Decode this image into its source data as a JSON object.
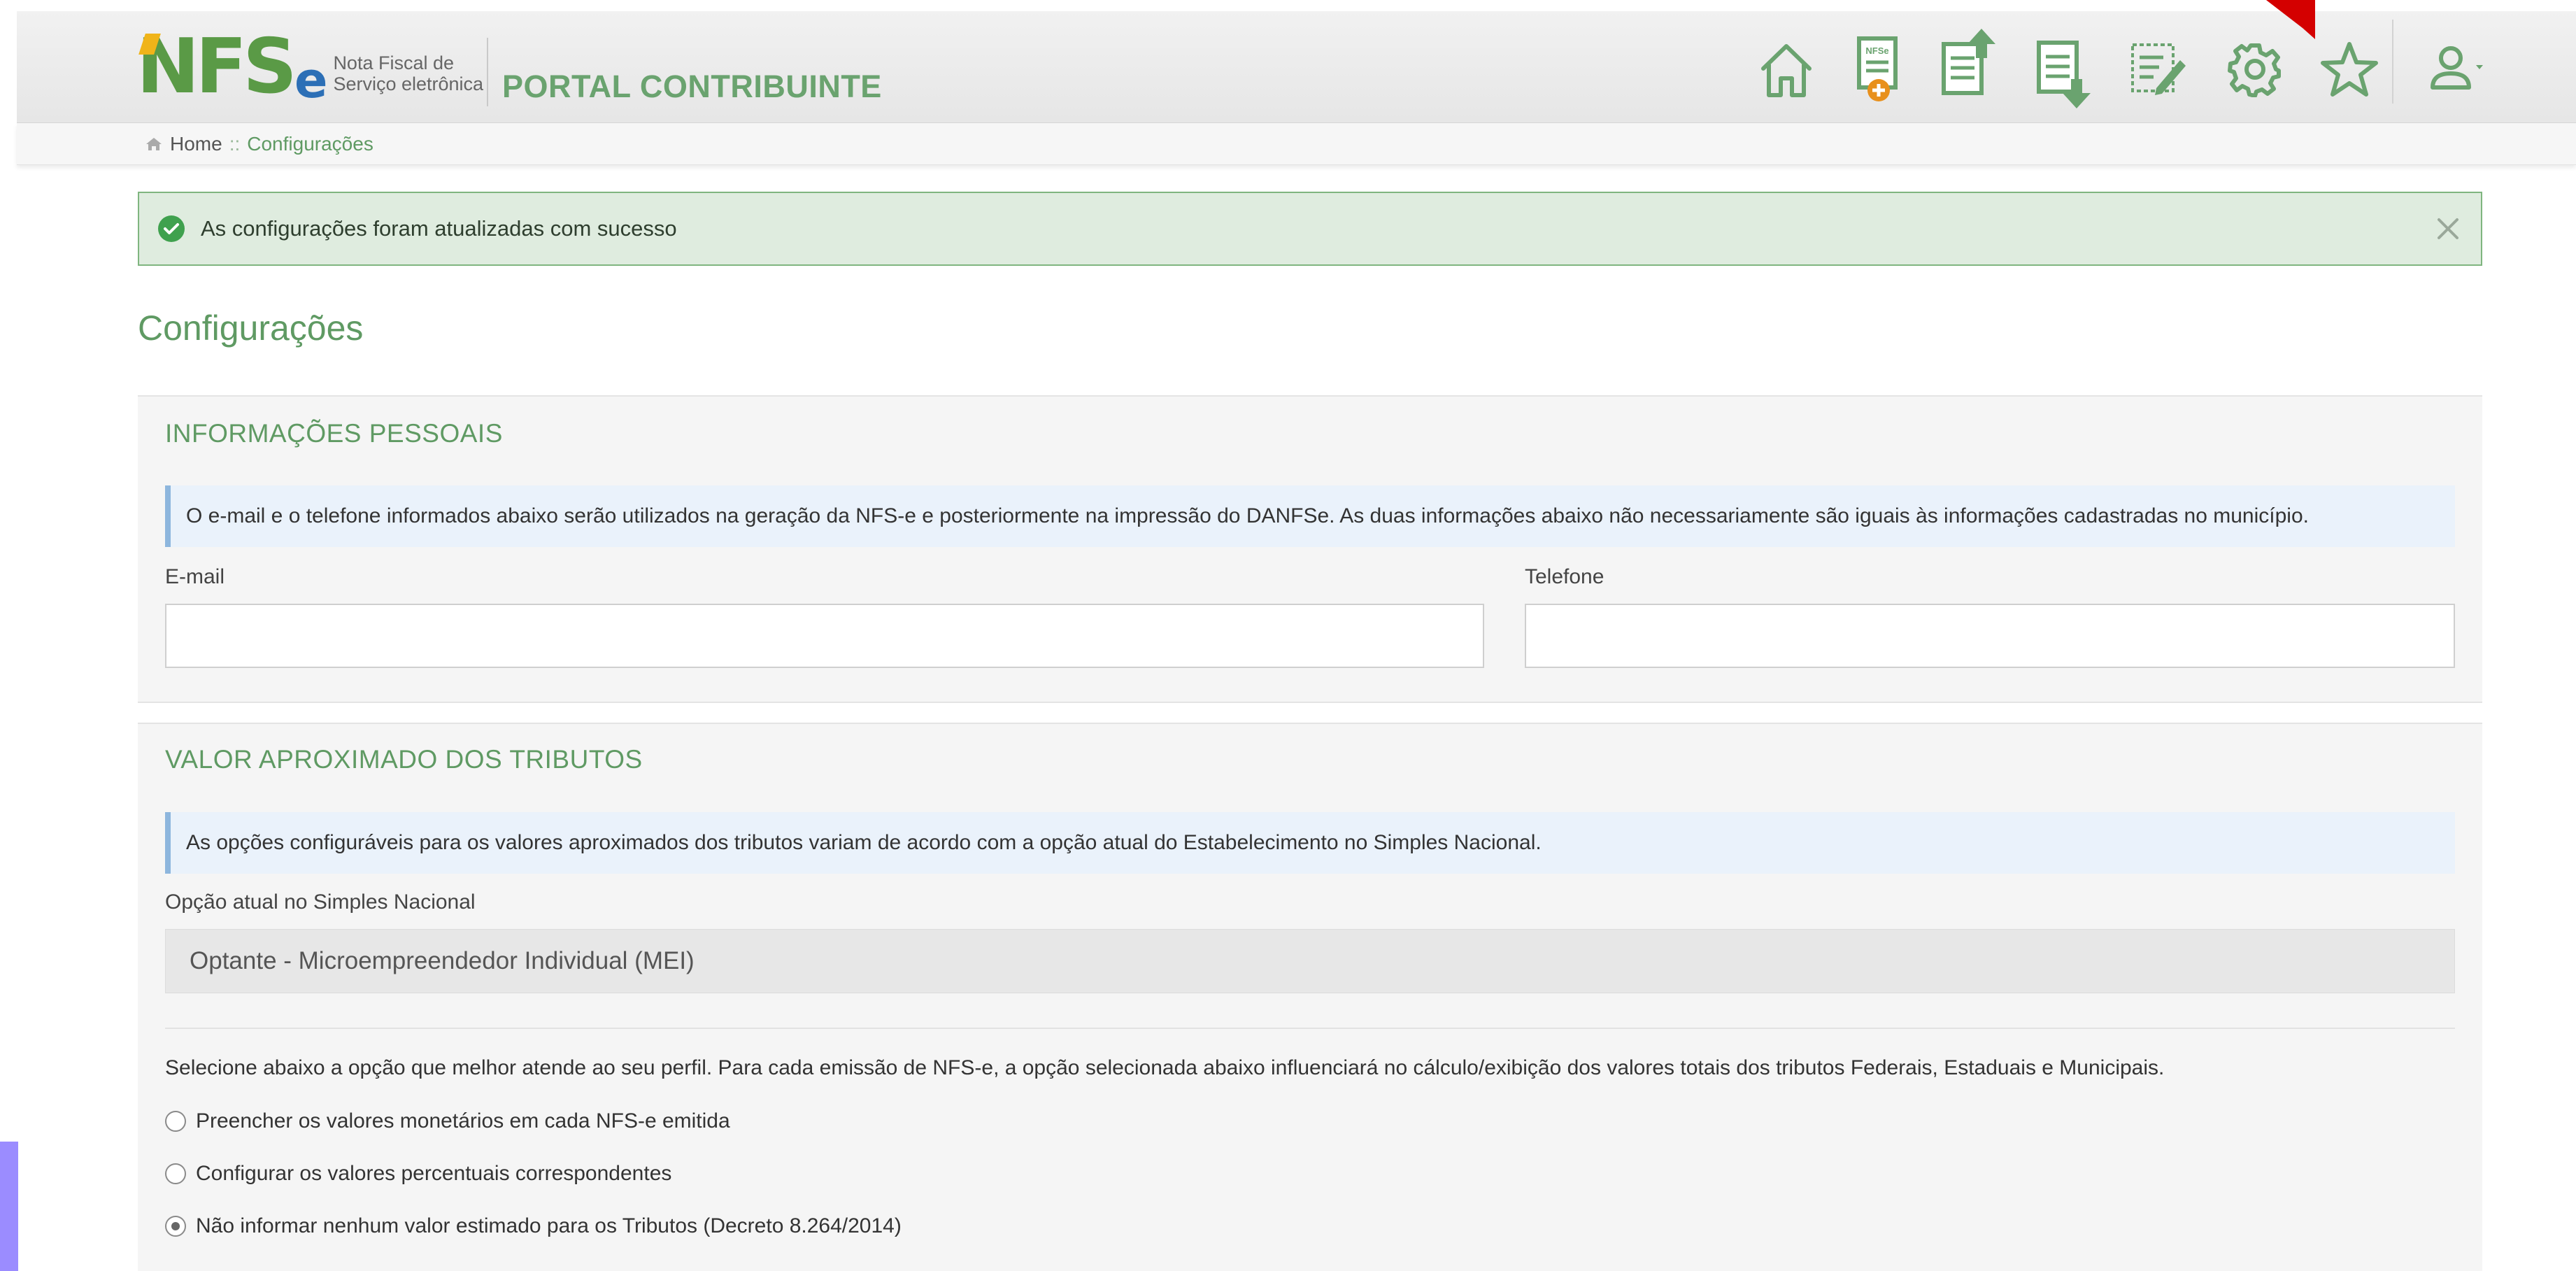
{
  "header": {
    "logo": {
      "mark": "NFS",
      "mark_e": "e",
      "subtitle_line1": "Nota Fiscal de",
      "subtitle_line2": "Serviço eletrônica"
    },
    "portal_title": "PORTAL CONTRIBUINTE",
    "nav_icons": [
      {
        "name": "home-icon"
      },
      {
        "name": "new-nfse-icon",
        "label": "NFSe"
      },
      {
        "name": "issued-notes-icon"
      },
      {
        "name": "received-notes-icon"
      },
      {
        "name": "edit-document-icon"
      },
      {
        "name": "gear-icon"
      },
      {
        "name": "star-icon"
      },
      {
        "name": "user-icon"
      }
    ],
    "accent_color": "#5f9a63",
    "arrow_color": "#d40000"
  },
  "breadcrumb": {
    "home": "Home",
    "separator": "::",
    "current": "Configurações"
  },
  "alert": {
    "message": "As configurações foram atualizadas com sucesso",
    "type": "success"
  },
  "page": {
    "title": "Configurações"
  },
  "personal_info": {
    "title": "INFORMAÇÕES PESSOAIS",
    "info": "O e-mail e o telefone informados abaixo serão utilizados na geração da NFS-e e posteriormente na impressão do DANFSe. As duas informações abaixo não necessariamente são iguais às informações cadastradas no município.",
    "email_label": "E-mail",
    "email_value": "",
    "phone_label": "Telefone",
    "phone_value": ""
  },
  "tributes": {
    "title": "VALOR APROXIMADO DOS TRIBUTOS",
    "info": "As opções configuráveis para os valores aproximados dos tributos variam de acordo com a opção atual do Estabelecimento no Simples Nacional.",
    "simples_label": "Opção atual no Simples Nacional",
    "simples_value": "Optante - Microempreendedor Individual (MEI)",
    "description": "Selecione abaixo a opção que melhor atende ao seu perfil. Para cada emissão de NFS-e, a opção selecionada abaixo influenciará no cálculo/exibição dos valores totais dos tributos Federais, Estaduais e Municipais.",
    "options": [
      {
        "label": "Preencher os valores monetários em cada NFS-e emitida",
        "checked": false
      },
      {
        "label": "Configurar os valores percentuais correspondentes",
        "checked": false
      },
      {
        "label": "Não informar nenhum valor estimado para os Tributos (Decreto 8.264/2014)",
        "checked": true
      }
    ]
  }
}
